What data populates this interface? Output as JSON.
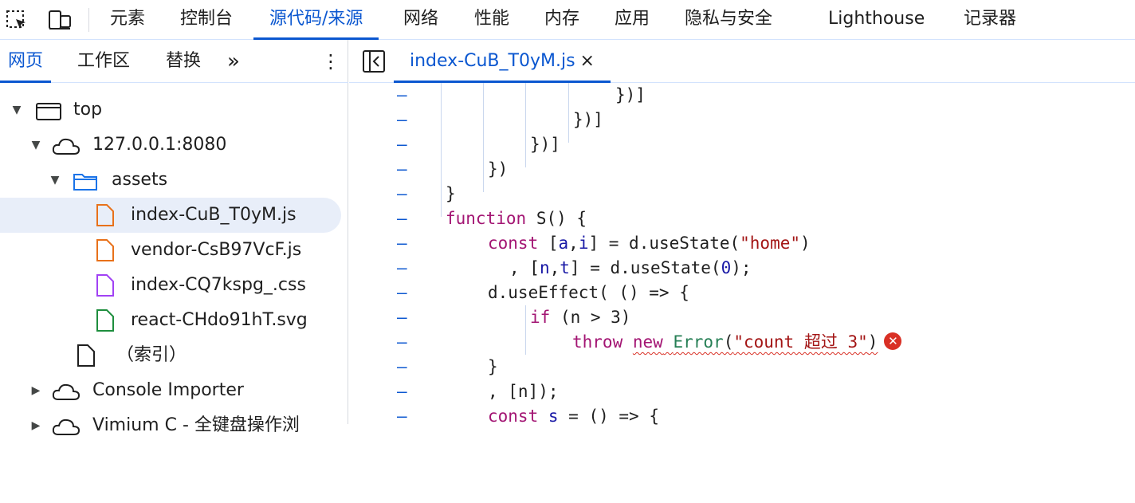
{
  "top_toolbar": {
    "inspect_icon": "select-element-icon",
    "device_icon": "device-toolbar-icon"
  },
  "panel_tabs": [
    {
      "label": "元素",
      "active": false
    },
    {
      "label": "控制台",
      "active": false
    },
    {
      "label": "源代码/来源",
      "active": true
    },
    {
      "label": "网络",
      "active": false
    },
    {
      "label": "性能",
      "active": false
    },
    {
      "label": "内存",
      "active": false
    },
    {
      "label": "应用",
      "active": false
    },
    {
      "label": "隐私与安全",
      "active": false
    },
    {
      "label": "Lighthouse",
      "active": false
    },
    {
      "label": "记录器",
      "active": false
    }
  ],
  "navigator": {
    "tabs": [
      {
        "label": "网页",
        "active": true
      },
      {
        "label": "工作区",
        "active": false
      },
      {
        "label": "替换",
        "active": false
      }
    ],
    "more_tabs": "»",
    "menu": "⋮",
    "tree": [
      {
        "label": "top",
        "icon": "frame-icon",
        "expanded": true
      },
      {
        "label": "127.0.0.1:8080",
        "icon": "cloud-icon",
        "expanded": true
      },
      {
        "label": "assets",
        "icon": "folder-icon",
        "expanded": true
      },
      {
        "label": "index-CuB_T0yM.js",
        "icon": "js-file-icon",
        "selected": true
      },
      {
        "label": "vendor-CsB97VcF.js",
        "icon": "js-file-icon"
      },
      {
        "label": "index-CQ7kspg_.css",
        "icon": "css-file-icon"
      },
      {
        "label": "react-CHdo91hT.svg",
        "icon": "svg-file-icon"
      },
      {
        "label": "（索引）",
        "icon": "document-icon"
      },
      {
        "label": "Console Importer",
        "icon": "cloud-icon",
        "expanded": false
      },
      {
        "label": "Vimium C - 全键盘操作浏",
        "icon": "cloud-icon",
        "expanded": false
      }
    ]
  },
  "editor": {
    "toggle_icon": "toggle-navigator-icon",
    "file_tab": {
      "label": "index-CuB_T0yM.js",
      "close": "×"
    },
    "gutter_mark": "–",
    "lines": [
      "})]",
      "})]",
      "})]",
      "})",
      "}",
      "function S() {",
      "const [a,i] = d.useState(\"home\")",
      ", [n,t] = d.useState(0);",
      "d.useEffect( () => {",
      "if (n > 3)",
      "throw new Error(\"count 超过 3\")",
      "}",
      ", [n]);",
      "const s = () => {"
    ],
    "error_badge": "✕"
  },
  "colors": {
    "accent": "#0b57d0",
    "keyword": "#a31573",
    "string": "#a31515",
    "number": "#1a1aa6",
    "class": "#267f55",
    "error": "#d93025",
    "selection": "#e8eef9"
  }
}
